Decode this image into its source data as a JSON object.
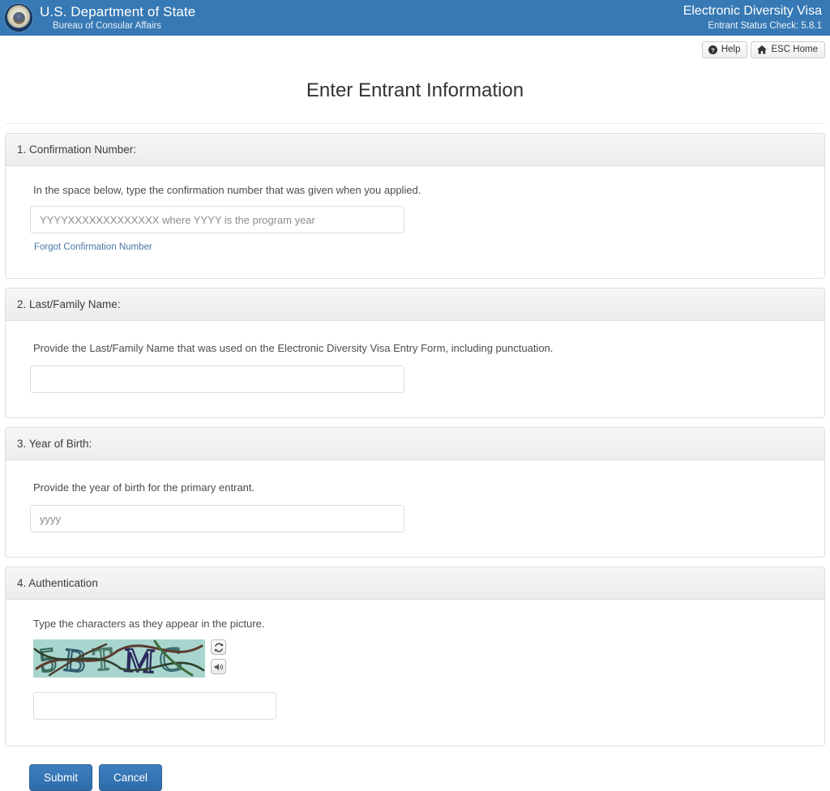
{
  "header": {
    "seal_icon": "us-department-of-state-seal",
    "agency_title": "U.S. Department of State",
    "agency_subtitle": "Bureau of Consular Affairs",
    "app_title": "Electronic Diversity Visa",
    "app_subtitle": "Entrant Status Check: 5.8.1",
    "brand_color": "#3779b4"
  },
  "utility": {
    "help_label": "Help",
    "help_icon": "question-circle-icon",
    "home_label": "ESC Home",
    "home_icon": "home-icon"
  },
  "page": {
    "title": "Enter Entrant Information"
  },
  "sections": [
    {
      "number": "1",
      "heading": "1. Confirmation Number:",
      "instruction": "In the space below, type the confirmation number that was given when you applied.",
      "input_placeholder": "YYYYXXXXXXXXXXXXX where YYYY is the program year",
      "input_value": "",
      "link_label": "Forgot Confirmation Number",
      "link_color": "#4a76a8"
    },
    {
      "number": "2",
      "heading": "2. Last/Family Name:",
      "instruction": "Provide the Last/Family Name that was used on the Electronic Diversity Visa Entry Form, including punctuation.",
      "input_placeholder": "",
      "input_value": ""
    },
    {
      "number": "3",
      "heading": "3. Year of Birth:",
      "instruction": "Provide the year of birth for the primary entrant.",
      "input_placeholder": "yyyy",
      "input_value": ""
    },
    {
      "number": "4",
      "heading": "4. Authentication",
      "instruction": "Type the characters as they appear in the picture.",
      "captcha_text": "5BTMC",
      "captcha_background": "#a8d5cd",
      "refresh_icon": "refresh-icon",
      "audio_icon": "audio-speaker-icon",
      "input_placeholder": "",
      "input_value": ""
    }
  ],
  "actions": {
    "submit_label": "Submit",
    "cancel_label": "Cancel",
    "button_color": "#3d7fc1"
  }
}
